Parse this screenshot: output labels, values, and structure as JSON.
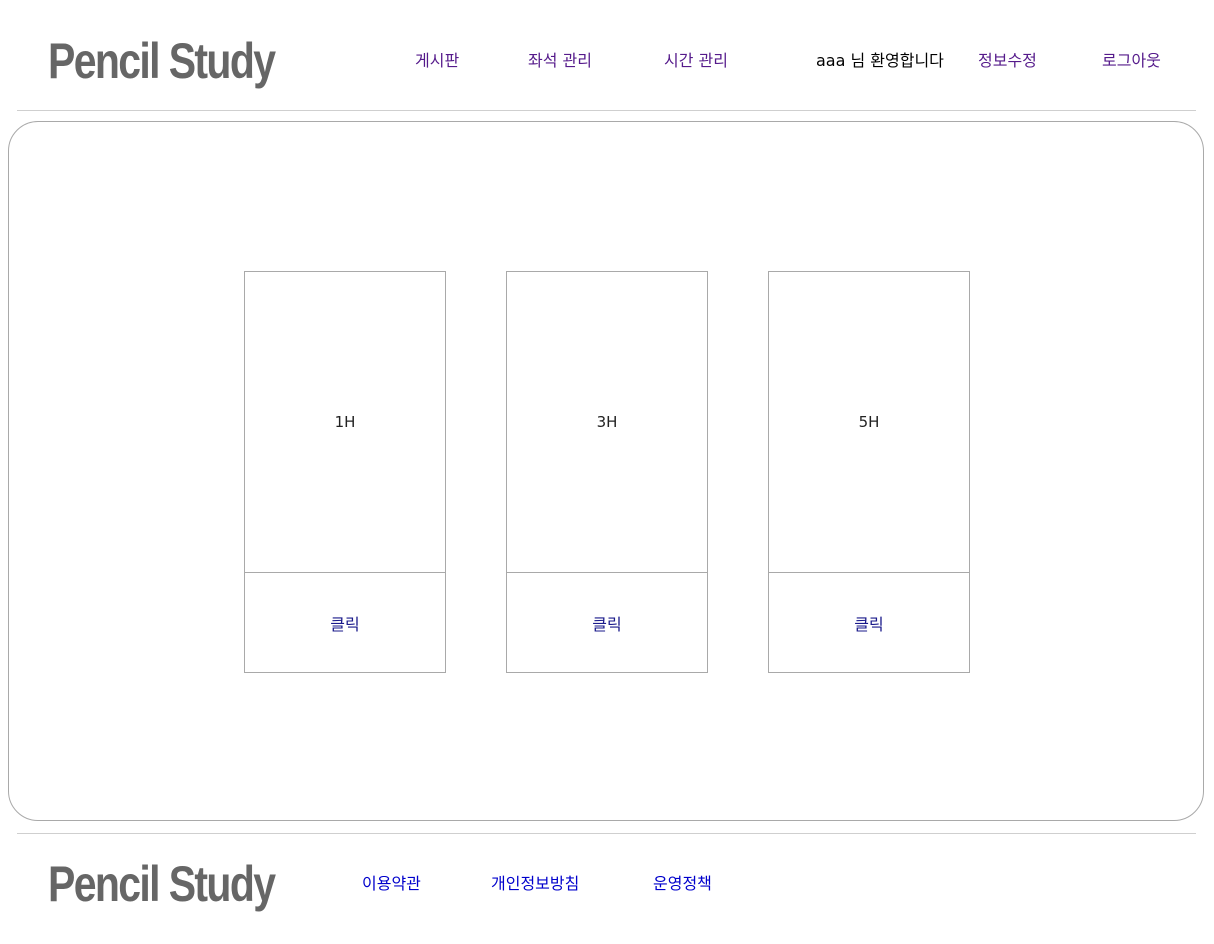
{
  "header": {
    "logo": "Pencil Study",
    "nav": {
      "board": "게시판",
      "seat_management": "좌석 관리",
      "time_management": "시간 관리"
    },
    "welcome": "aaa 님 환영합니다",
    "edit_profile": "정보수정",
    "logout": "로그아웃"
  },
  "plans": [
    {
      "label": "1H",
      "action": "클릭"
    },
    {
      "label": "3H",
      "action": "클릭"
    },
    {
      "label": "5H",
      "action": "클릭"
    }
  ],
  "footer": {
    "logo": "Pencil Study",
    "links": {
      "terms": "이용약관",
      "privacy": "개인정보방침",
      "policy": "운영정책"
    }
  },
  "colors": {
    "logo": "#666666",
    "visited_link": "#551a8b",
    "footer_link": "#0000cc",
    "border": "#a9a9a9"
  }
}
